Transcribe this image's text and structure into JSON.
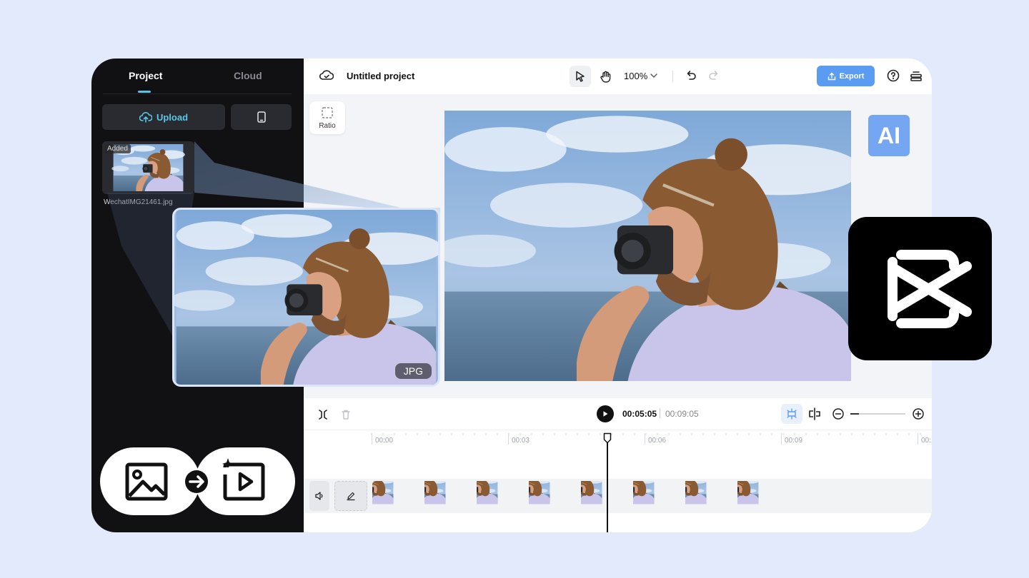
{
  "sidebar": {
    "tabs": [
      {
        "label": "Project",
        "active": true
      },
      {
        "label": "Cloud",
        "active": false
      }
    ],
    "upload_label": "Upload",
    "media": [
      {
        "badge": "Added",
        "filename": "WechatIMG21461.jpg"
      }
    ]
  },
  "topbar": {
    "project_title": "Untitled project",
    "zoom_level": "100%",
    "export_label": "Export"
  },
  "canvas": {
    "ratio_label": "Ratio",
    "ai_badge": "AI"
  },
  "timeline": {
    "current_time": "00:05:05",
    "total_time": "00:09:05",
    "ruler_ticks": [
      "00:00",
      "00:03",
      "00:06",
      "00:09",
      "00:"
    ]
  },
  "overlay": {
    "format_badge": "JPG"
  },
  "colors": {
    "accent": "#5b9cf3",
    "upload_text": "#59c8e7",
    "page_background": "#e2eafb",
    "sidebar_background": "#111113"
  }
}
